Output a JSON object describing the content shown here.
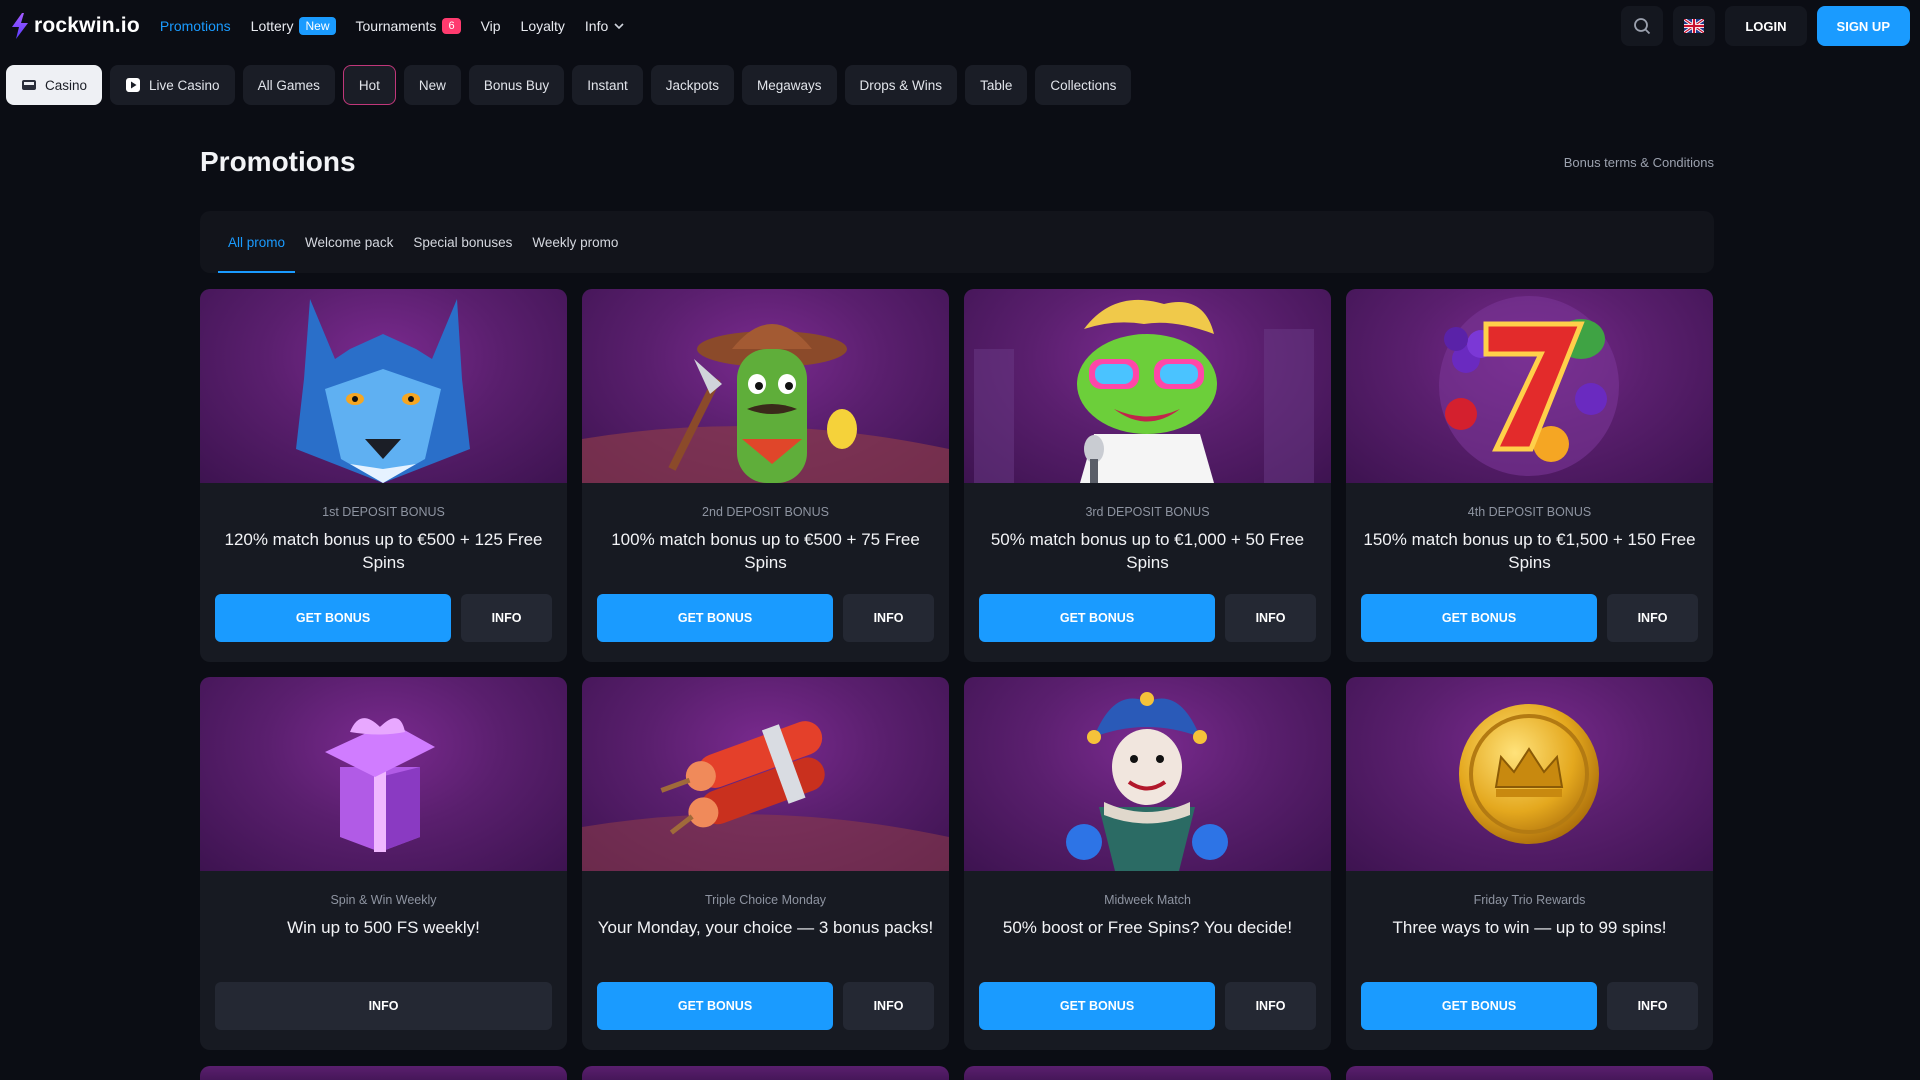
{
  "header": {
    "logo_text": "rockwin.io",
    "nav": [
      {
        "label": "Promotions",
        "active": true
      },
      {
        "label": "Lottery",
        "badge": "New"
      },
      {
        "label": "Tournaments",
        "count": "6"
      },
      {
        "label": "Vip"
      },
      {
        "label": "Loyalty"
      },
      {
        "label": "Info"
      }
    ],
    "login_label": "LOGIN",
    "signup_label": "SIGN UP",
    "colors": {
      "accent": "#1a9bff",
      "count_badge": "#ff3b6f",
      "background": "#0b0d14"
    }
  },
  "categories": [
    {
      "label": "Casino",
      "icon": "casino-icon"
    },
    {
      "label": "Live Casino",
      "icon": "play-icon"
    },
    {
      "label": "All Games"
    },
    {
      "label": "Hot"
    },
    {
      "label": "New"
    },
    {
      "label": "Bonus Buy"
    },
    {
      "label": "Instant"
    },
    {
      "label": "Jackpots"
    },
    {
      "label": "Megaways"
    },
    {
      "label": "Drops & Wins"
    },
    {
      "label": "Table"
    },
    {
      "label": "Collections"
    }
  ],
  "page": {
    "title": "Promotions",
    "terms_link": "Bonus terms & Conditions"
  },
  "tabs": [
    {
      "label": "All promo",
      "active": true
    },
    {
      "label": "Welcome pack"
    },
    {
      "label": "Special bonuses"
    },
    {
      "label": "Weekly promo"
    }
  ],
  "cards": [
    {
      "subtitle": "1st DEPOSIT BONUS",
      "title": "120% match bonus up to €500 + 125 Free Spins",
      "bonus_label": "GET BONUS",
      "info_label": "INFO",
      "art": "wolf"
    },
    {
      "subtitle": "2nd DEPOSIT BONUS",
      "title": "100% match bonus up to €500 + 75 Free Spins",
      "bonus_label": "GET BONUS",
      "info_label": "INFO",
      "art": "cactus-cowboy"
    },
    {
      "subtitle": "3rd DEPOSIT BONUS",
      "title": "50% match bonus up to €1,000 + 50 Free Spins",
      "bonus_label": "GET BONUS",
      "info_label": "INFO",
      "art": "rockstar-frog"
    },
    {
      "subtitle": "4th DEPOSIT BONUS",
      "title": "150% match bonus up to €1,500 + 150 Free Spins",
      "bonus_label": "GET BONUS",
      "info_label": "INFO",
      "art": "lucky-seven"
    },
    {
      "subtitle": "Spin & Win Weekly",
      "title": "Win up to 500 FS weekly!",
      "info_label": "INFO",
      "art": "gift-box"
    },
    {
      "subtitle": "Triple Choice Monday",
      "title": "Your Monday, your choice — 3 bonus packs!",
      "bonus_label": "GET BONUS",
      "info_label": "INFO",
      "art": "dynamite"
    },
    {
      "subtitle": "Midweek Match",
      "title": "50% boost or Free Spins? You decide!",
      "bonus_label": "GET BONUS",
      "info_label": "INFO",
      "art": "jester"
    },
    {
      "subtitle": "Friday Trio Rewards",
      "title": "Three ways to win — up to 99 spins!",
      "bonus_label": "GET BONUS",
      "info_label": "INFO",
      "art": "gold-coin"
    }
  ]
}
